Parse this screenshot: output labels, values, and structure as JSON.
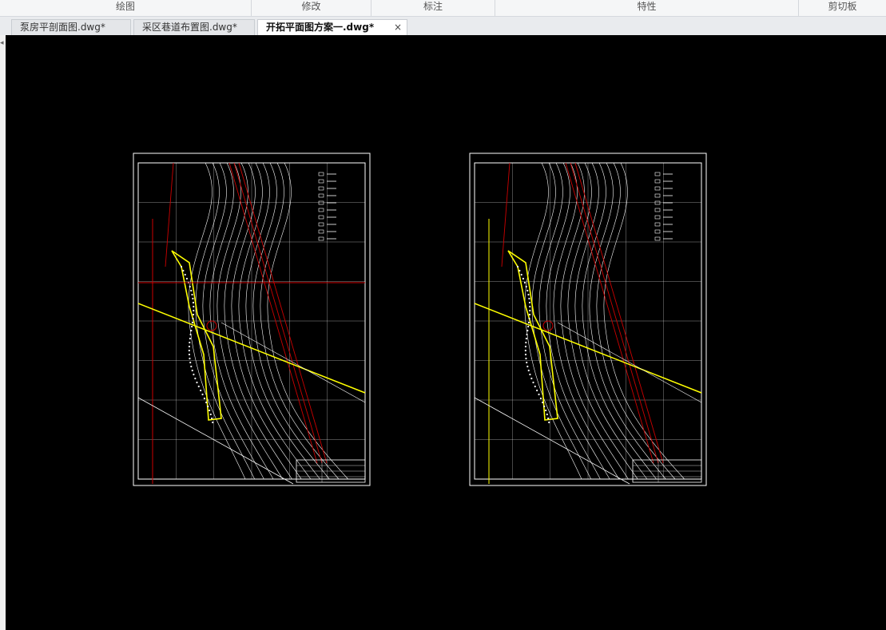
{
  "ribbon": {
    "panels": [
      "绘图",
      "修改",
      "标注",
      "特性",
      "剪切板"
    ]
  },
  "tabs": [
    {
      "label": "泵房平剖面图.dwg*",
      "active": false
    },
    {
      "label": "采区巷道布置图.dwg*",
      "active": false
    },
    {
      "label": "开拓平面图方案一.dwg*",
      "active": true
    }
  ],
  "tab_close_glyph": "×",
  "left_edge_glyph": "◂",
  "colors": {
    "canvas_bg": "#000000",
    "frame": "#ffffff",
    "grid": "#ffffff",
    "fault": "#cc0000",
    "highlight": "#ffff00"
  },
  "drawings": [
    {
      "name": "sheet-left",
      "vertical_axis_color": "#cc0000"
    },
    {
      "name": "sheet-right",
      "vertical_axis_color": "#ffff00"
    }
  ]
}
